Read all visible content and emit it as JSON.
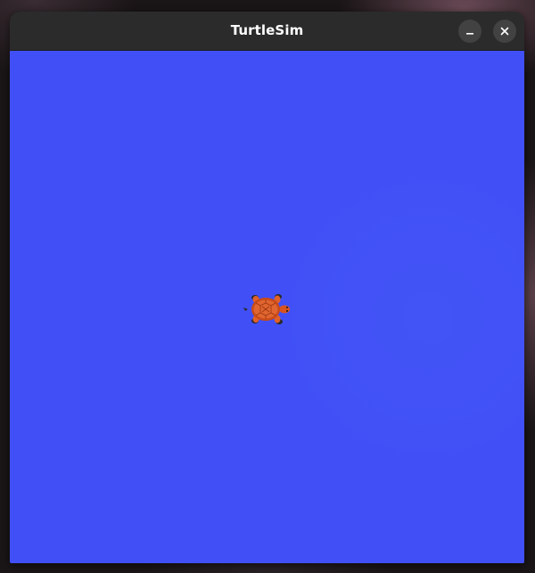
{
  "window": {
    "title": "TurtleSim",
    "minimize_icon": "minimize-icon",
    "close_icon": "close-icon"
  },
  "canvas": {
    "background_color": "#4050f6",
    "sprite": "turtle-icon"
  },
  "colors": {
    "titlebar": "#2b2b2b",
    "title_text": "#ffffff",
    "button_bg": "#424242",
    "turtle_shell": "#d9541e",
    "turtle_limbs": "#2a2a2a"
  }
}
